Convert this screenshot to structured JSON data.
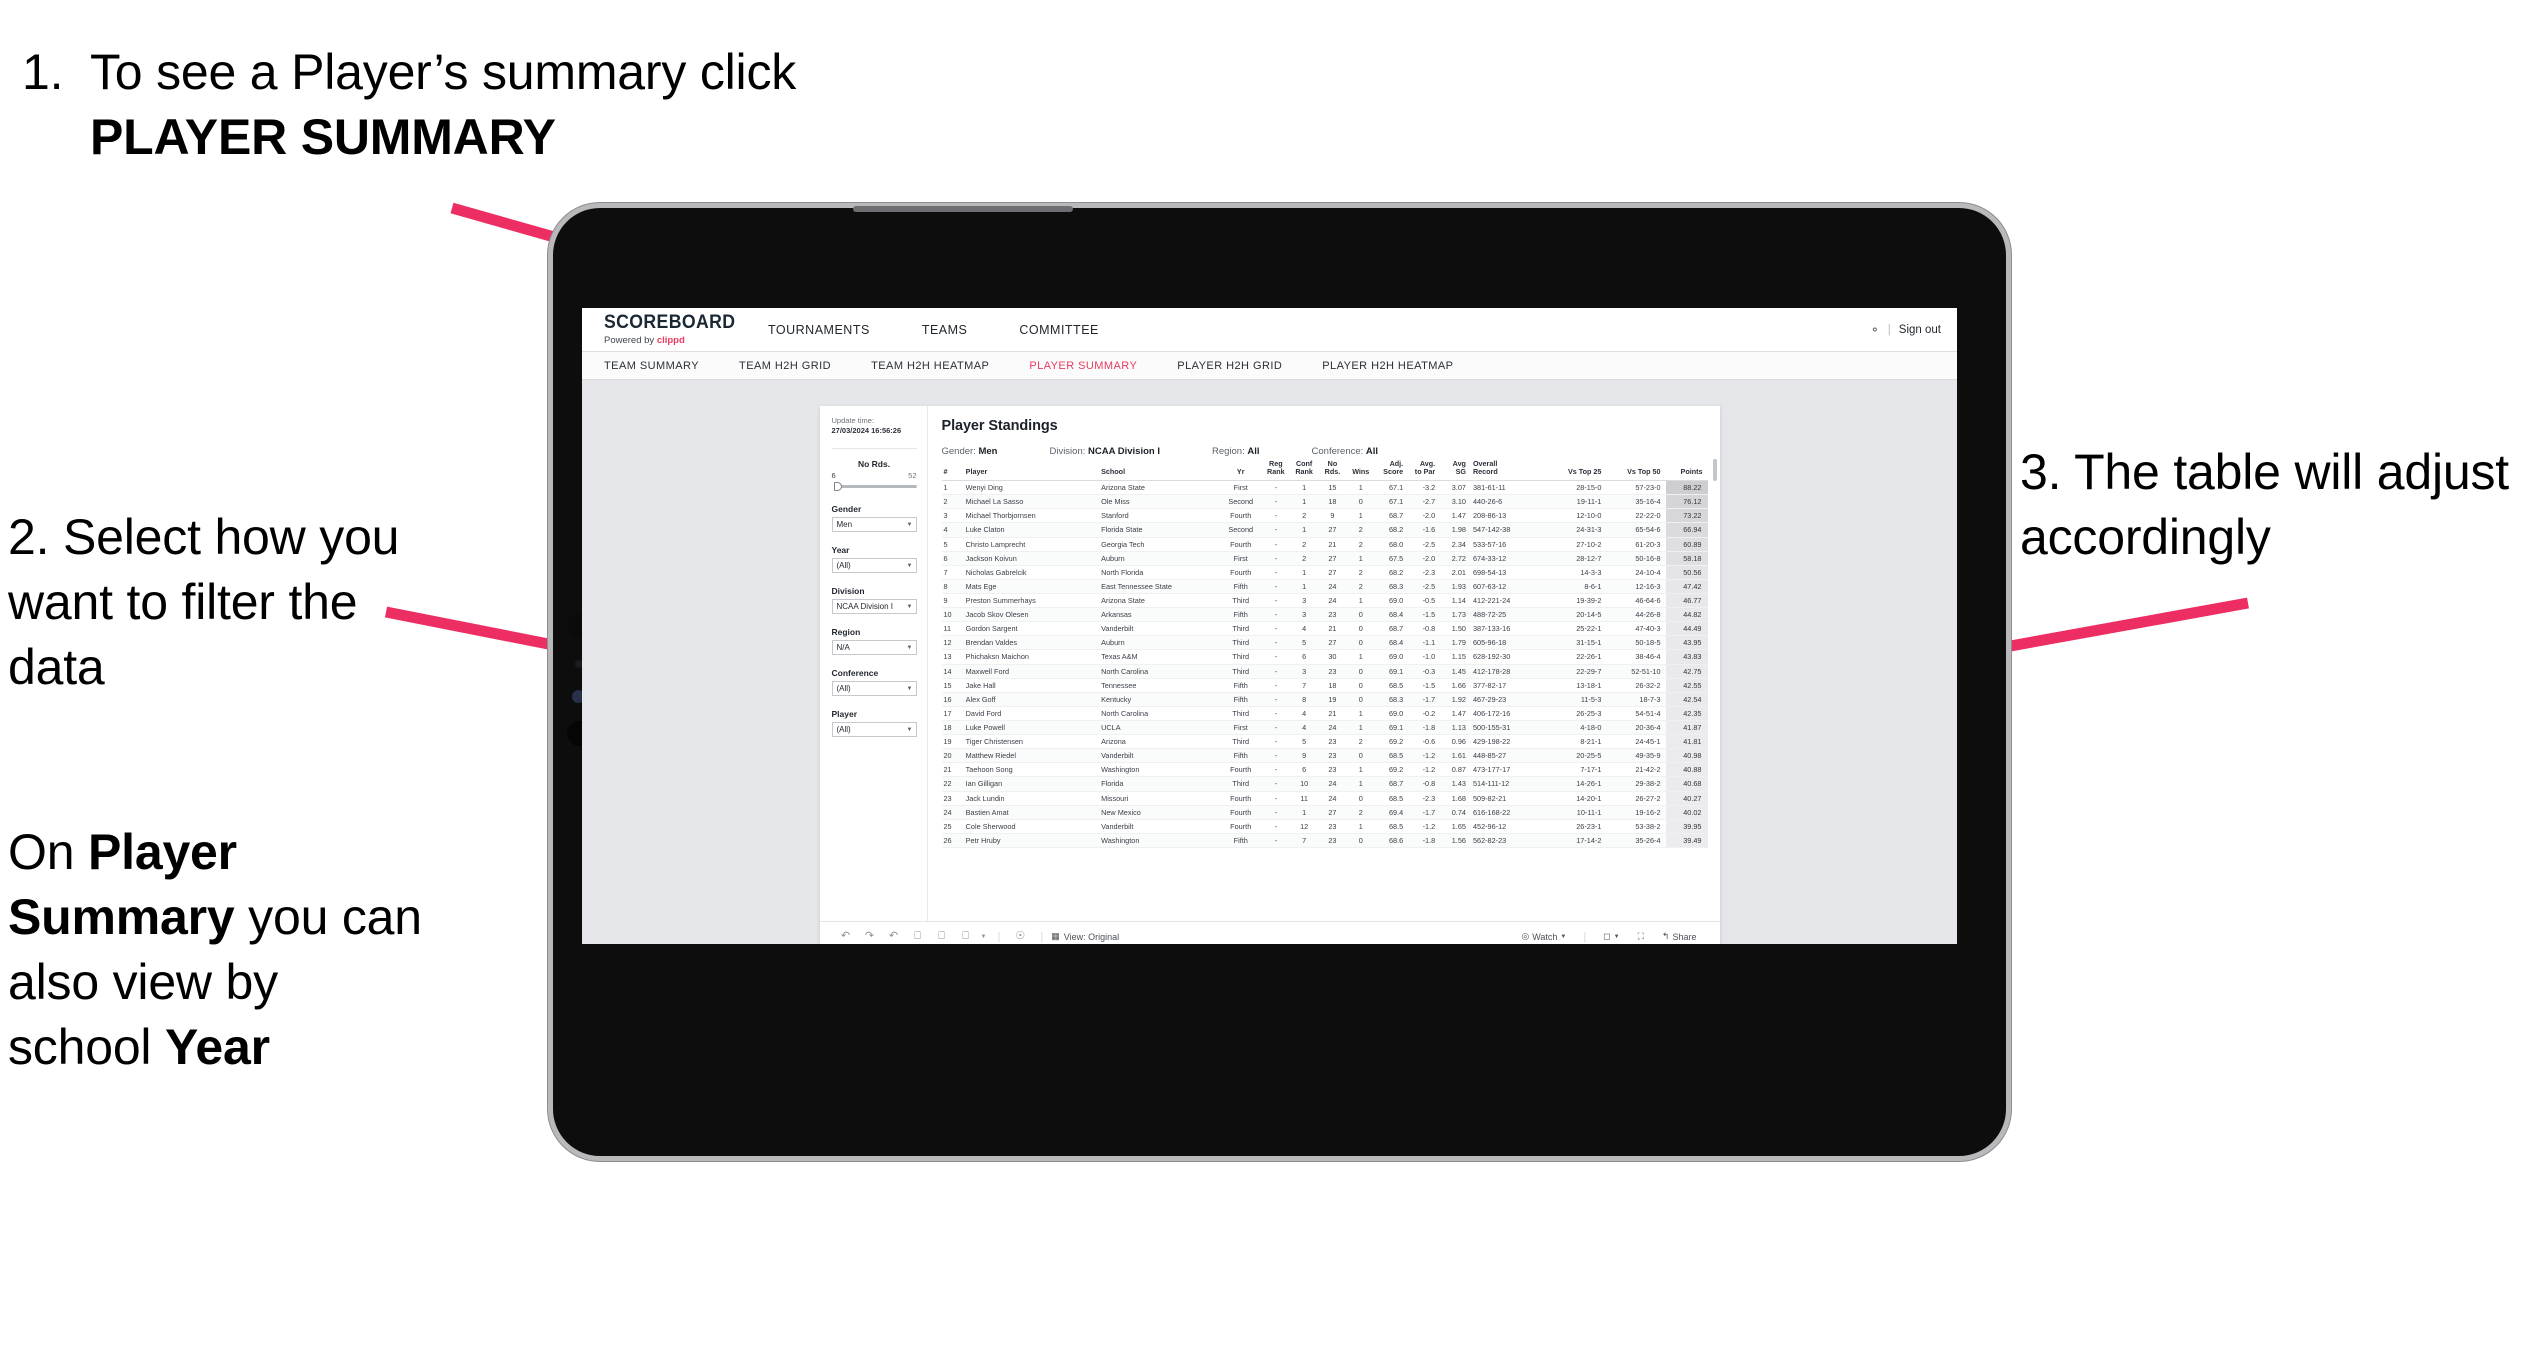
{
  "annotations": {
    "step1": {
      "number": "1.",
      "text_before": "To see a Player’s summary click ",
      "bold": "PLAYER SUMMARY"
    },
    "step2": {
      "text": "2. Select how you want to filter the data"
    },
    "step2b": {
      "before": "On ",
      "bold1": "Player Summary",
      "middle": " you can also view by school ",
      "bold2": "Year"
    },
    "step3": {
      "text": "3. The table will adjust accordingly"
    },
    "arrow_color": "#ED2E63"
  },
  "app": {
    "logo": {
      "title": "SCOREBOARD",
      "powered_prefix": "Powered by ",
      "brand": "clippd"
    },
    "top_nav": [
      "TOURNAMENTS",
      "TEAMS",
      "COMMITTEE"
    ],
    "account": {
      "icon": "account-icon",
      "separator": "|",
      "sign_out": "Sign out"
    },
    "sub_nav": [
      {
        "label": "TEAM SUMMARY",
        "active": false
      },
      {
        "label": "TEAM H2H GRID",
        "active": false
      },
      {
        "label": "TEAM H2H HEATMAP",
        "active": false
      },
      {
        "label": "PLAYER SUMMARY",
        "active": true
      },
      {
        "label": "PLAYER H2H GRID",
        "active": false
      },
      {
        "label": "PLAYER H2H HEATMAP",
        "active": false
      }
    ],
    "accent_color": "#EA3B61",
    "filters": {
      "update_label": "Update time:",
      "update_time": "27/03/2024 16:56:26",
      "slider": {
        "label": "No Rds.",
        "min": "6",
        "max": "52"
      },
      "groups": [
        {
          "label": "Gender",
          "value": "Men"
        },
        {
          "label": "Year",
          "value": "(All)"
        },
        {
          "label": "Division",
          "value": "NCAA Division I"
        },
        {
          "label": "Region",
          "value": "N/A"
        },
        {
          "label": "Conference",
          "value": "(All)"
        },
        {
          "label": "Player",
          "value": "(All)"
        }
      ]
    },
    "table": {
      "title": "Player Standings",
      "meta": [
        {
          "label": "Gender:",
          "value": "Men"
        },
        {
          "label": "Division:",
          "value": "NCAA Division I"
        },
        {
          "label": "Region:",
          "value": "All"
        },
        {
          "label": "Conference:",
          "value": "All"
        }
      ],
      "columns": [
        "#",
        "Player",
        "School",
        "Yr",
        "Reg Rank",
        "Conf Rank",
        "No Rds.",
        "Wins",
        "Adj. Score",
        "Avg. to Par",
        "Avg SG",
        "Overall Record",
        "Vs Top 25",
        "Vs Top 50",
        "Points"
      ],
      "rows": [
        [
          "1",
          "Wenyi Ding",
          "Arizona State",
          "First",
          "-",
          "1",
          "15",
          "1",
          "67.1",
          "-3.2",
          "3.07",
          "381-61-11",
          "28-15-0",
          "57-23-0",
          "88.22"
        ],
        [
          "2",
          "Michael La Sasso",
          "Ole Miss",
          "Second",
          "-",
          "1",
          "18",
          "0",
          "67.1",
          "-2.7",
          "3.10",
          "440-26-6",
          "19-11-1",
          "35-16-4",
          "76.12"
        ],
        [
          "3",
          "Michael Thorbjornsen",
          "Stanford",
          "Fourth",
          "-",
          "2",
          "9",
          "1",
          "68.7",
          "-2.0",
          "1.47",
          "208-86-13",
          "12-10-0",
          "22-22-0",
          "73.22"
        ],
        [
          "4",
          "Luke Claton",
          "Florida State",
          "Second",
          "-",
          "1",
          "27",
          "2",
          "68.2",
          "-1.6",
          "1.98",
          "547-142-38",
          "24-31-3",
          "65-54-6",
          "66.94"
        ],
        [
          "5",
          "Christo Lamprecht",
          "Georgia Tech",
          "Fourth",
          "-",
          "2",
          "21",
          "2",
          "68.0",
          "-2.5",
          "2.34",
          "533-57-16",
          "27-10-2",
          "61-20-3",
          "60.89"
        ],
        [
          "6",
          "Jackson Koivun",
          "Auburn",
          "First",
          "-",
          "2",
          "27",
          "1",
          "67.5",
          "-2.0",
          "2.72",
          "674-33-12",
          "28-12-7",
          "50-16-8",
          "58.18"
        ],
        [
          "7",
          "Nicholas Gabrelcik",
          "North Florida",
          "Fourth",
          "-",
          "1",
          "27",
          "2",
          "68.2",
          "-2.3",
          "2.01",
          "698-54-13",
          "14-3-3",
          "24-10-4",
          "50.56"
        ],
        [
          "8",
          "Mats Ege",
          "East Tennessee State",
          "Fifth",
          "-",
          "1",
          "24",
          "2",
          "68.3",
          "-2.5",
          "1.93",
          "607-63-12",
          "8-6-1",
          "12-16-3",
          "47.42"
        ],
        [
          "9",
          "Preston Summerhays",
          "Arizona State",
          "Third",
          "-",
          "3",
          "24",
          "1",
          "69.0",
          "-0.5",
          "1.14",
          "412-221-24",
          "19-39-2",
          "46-64-6",
          "46.77"
        ],
        [
          "10",
          "Jacob Skov Olesen",
          "Arkansas",
          "Fifth",
          "-",
          "3",
          "23",
          "0",
          "68.4",
          "-1.5",
          "1.73",
          "488-72-25",
          "20-14-5",
          "44-26-8",
          "44.82"
        ],
        [
          "11",
          "Gordon Sargent",
          "Vanderbilt",
          "Third",
          "-",
          "4",
          "21",
          "0",
          "68.7",
          "-0.8",
          "1.50",
          "387-133-16",
          "25-22-1",
          "47-40-3",
          "44.49"
        ],
        [
          "12",
          "Brendan Valdes",
          "Auburn",
          "Third",
          "-",
          "5",
          "27",
          "0",
          "68.4",
          "-1.1",
          "1.79",
          "605-96-18",
          "31-15-1",
          "50-18-5",
          "43.95"
        ],
        [
          "13",
          "Phichaksn Maichon",
          "Texas A&M",
          "Third",
          "-",
          "6",
          "30",
          "1",
          "69.0",
          "-1.0",
          "1.15",
          "628-192-30",
          "22-26-1",
          "38-46-4",
          "43.83"
        ],
        [
          "14",
          "Maxwell Ford",
          "North Carolina",
          "Third",
          "-",
          "3",
          "23",
          "0",
          "69.1",
          "-0.3",
          "1.45",
          "412-178-28",
          "22-29-7",
          "52-51-10",
          "42.75"
        ],
        [
          "15",
          "Jake Hall",
          "Tennessee",
          "Fifth",
          "-",
          "7",
          "18",
          "0",
          "68.5",
          "-1.5",
          "1.66",
          "377-82-17",
          "13-18-1",
          "26-32-2",
          "42.55"
        ],
        [
          "16",
          "Alex Goff",
          "Kentucky",
          "Fifth",
          "-",
          "8",
          "19",
          "0",
          "68.3",
          "-1.7",
          "1.92",
          "467-29-23",
          "11-5-3",
          "18-7-3",
          "42.54"
        ],
        [
          "17",
          "David Ford",
          "North Carolina",
          "Third",
          "-",
          "4",
          "21",
          "1",
          "69.0",
          "-0.2",
          "1.47",
          "406-172-16",
          "26-25-3",
          "54-51-4",
          "42.35"
        ],
        [
          "18",
          "Luke Powell",
          "UCLA",
          "First",
          "-",
          "4",
          "24",
          "1",
          "69.1",
          "-1.8",
          "1.13",
          "500-155-31",
          "4-18-0",
          "20-36-4",
          "41.87"
        ],
        [
          "19",
          "Tiger Christensen",
          "Arizona",
          "Third",
          "-",
          "5",
          "23",
          "2",
          "69.2",
          "-0.6",
          "0.96",
          "429-198-22",
          "8-21-1",
          "24-45-1",
          "41.81"
        ],
        [
          "20",
          "Matthew Riedel",
          "Vanderbilt",
          "Fifth",
          "-",
          "9",
          "23",
          "0",
          "68.5",
          "-1.2",
          "1.61",
          "448-85-27",
          "20-25-5",
          "49-35-9",
          "40.98"
        ],
        [
          "21",
          "Taehoon Song",
          "Washington",
          "Fourth",
          "-",
          "6",
          "23",
          "1",
          "69.2",
          "-1.2",
          "0.87",
          "473-177-17",
          "7-17-1",
          "21-42-2",
          "40.88"
        ],
        [
          "22",
          "Ian Gilligan",
          "Florida",
          "Third",
          "-",
          "10",
          "24",
          "1",
          "68.7",
          "-0.8",
          "1.43",
          "514-111-12",
          "14-26-1",
          "29-38-2",
          "40.68"
        ],
        [
          "23",
          "Jack Lundin",
          "Missouri",
          "Fourth",
          "-",
          "11",
          "24",
          "0",
          "68.5",
          "-2.3",
          "1.68",
          "509-82-21",
          "14-20-1",
          "26-27-2",
          "40.27"
        ],
        [
          "24",
          "Bastien Amat",
          "New Mexico",
          "Fourth",
          "-",
          "1",
          "27",
          "2",
          "69.4",
          "-1.7",
          "0.74",
          "616-168-22",
          "10-11-1",
          "19-16-2",
          "40.02"
        ],
        [
          "25",
          "Cole Sherwood",
          "Vanderbilt",
          "Fourth",
          "-",
          "12",
          "23",
          "1",
          "68.5",
          "-1.2",
          "1.65",
          "452-96-12",
          "26-23-1",
          "53-38-2",
          "39.95"
        ],
        [
          "26",
          "Petr Hruby",
          "Washington",
          "Fifth",
          "-",
          "7",
          "23",
          "0",
          "68.6",
          "-1.8",
          "1.56",
          "562-82-23",
          "17-14-2",
          "35-26-4",
          "39.49"
        ]
      ]
    },
    "toolbar": {
      "left_icons": [
        "undo-icon",
        "redo-icon",
        "revert-icon",
        "refresh-icon",
        "pause-icon",
        "reset-icon",
        "caret-down-icon"
      ],
      "help_icon": "help-icon",
      "view_icon": "view-icon",
      "view_label": "View: Original",
      "watch_icon": "watch-icon",
      "watch_label": "Watch",
      "watch_caret": "▾",
      "download_icon": "download-icon",
      "download_caret": "▾",
      "fullscreen_icon": "fullscreen-icon",
      "share_icon": "share-icon",
      "share_label": "Share"
    }
  }
}
